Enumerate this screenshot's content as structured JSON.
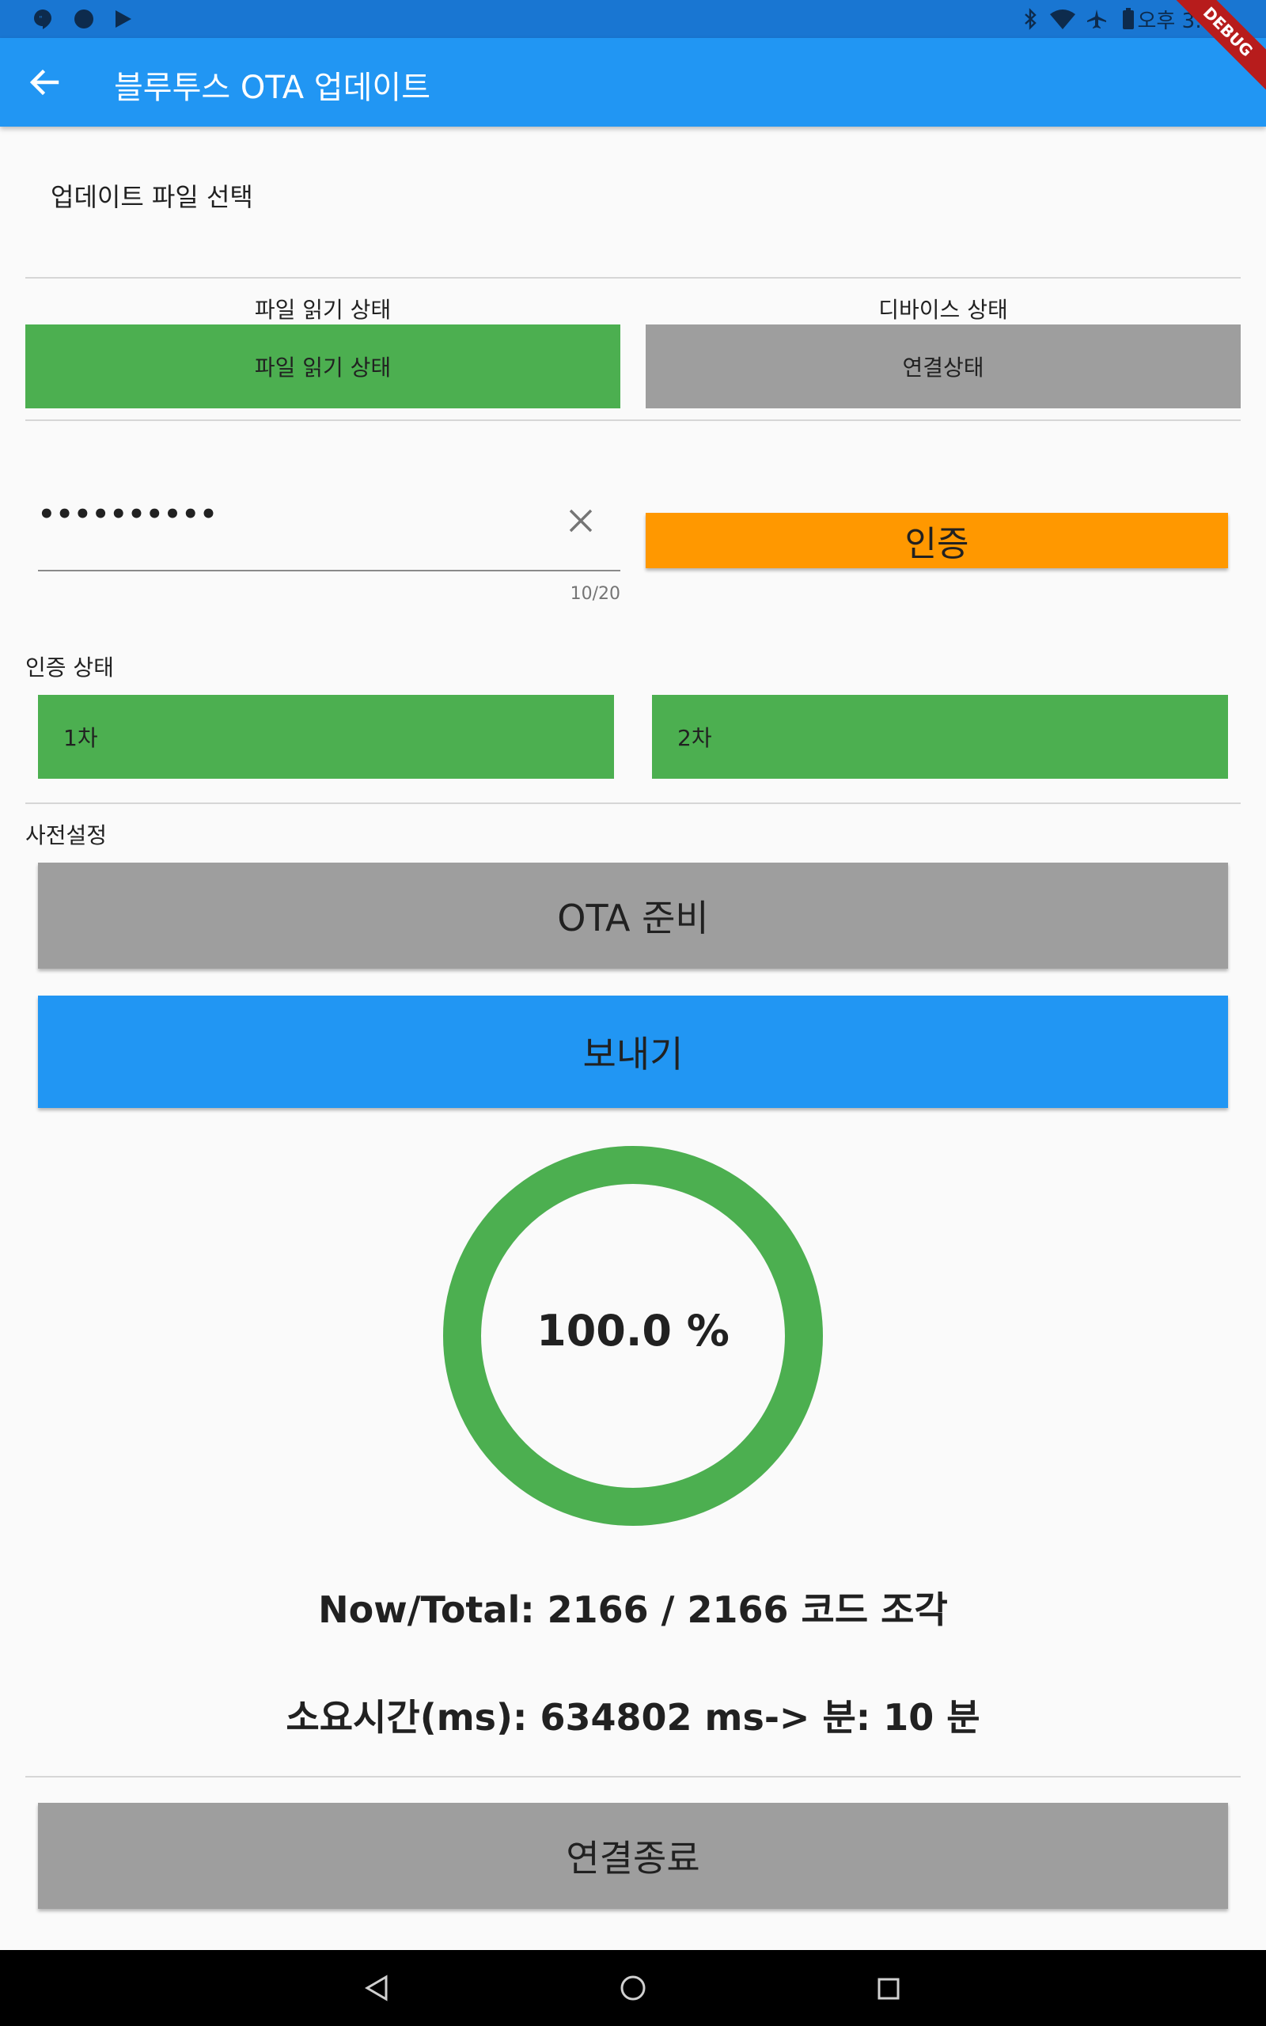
{
  "status_bar": {
    "left_icons": [
      "hangouts-icon",
      "circle-notification-icon",
      "play-store-icon"
    ],
    "right_icons": [
      "bluetooth-icon",
      "wifi-icon",
      "airplane-icon",
      "battery-icon"
    ],
    "time": "오후 3:43",
    "debug_ribbon": "DEBUG"
  },
  "appbar": {
    "title": "블루투스 OTA 업데이트",
    "back_icon": "arrow-back-icon"
  },
  "file_select": {
    "label": "업데이트 파일 선택"
  },
  "status": {
    "file_read": {
      "heading": "파일 읽기 상태",
      "value": "파일 읽기 상태",
      "color": "#4caf50"
    },
    "device": {
      "heading": "디바이스 상태",
      "value": "연결상태",
      "color": "#9e9e9e"
    }
  },
  "auth": {
    "password_mask": "••••••••••",
    "counter": "10/20",
    "clear_icon": "close-icon",
    "button_label": "인증",
    "button_color": "#ff9800",
    "section_label": "인증 상태",
    "stage1": "1차",
    "stage2": "2차"
  },
  "preset": {
    "section_label": "사전설정",
    "ota_ready_label": "OTA 준비",
    "send_label": "보내기",
    "send_color": "#2196f3"
  },
  "progress": {
    "percent_text": "100.0 %",
    "fraction": 1.0,
    "ring_color": "#4caf50",
    "now_total": "Now/Total: 2166 / 2166 코드 조각",
    "elapsed": "소요시간(ms): 634802 ms-> 분: 10 분"
  },
  "disconnect": {
    "label": "연결종료"
  },
  "nav": {
    "icons": [
      "back-triangle-icon",
      "home-circle-icon",
      "recents-square-icon"
    ]
  }
}
